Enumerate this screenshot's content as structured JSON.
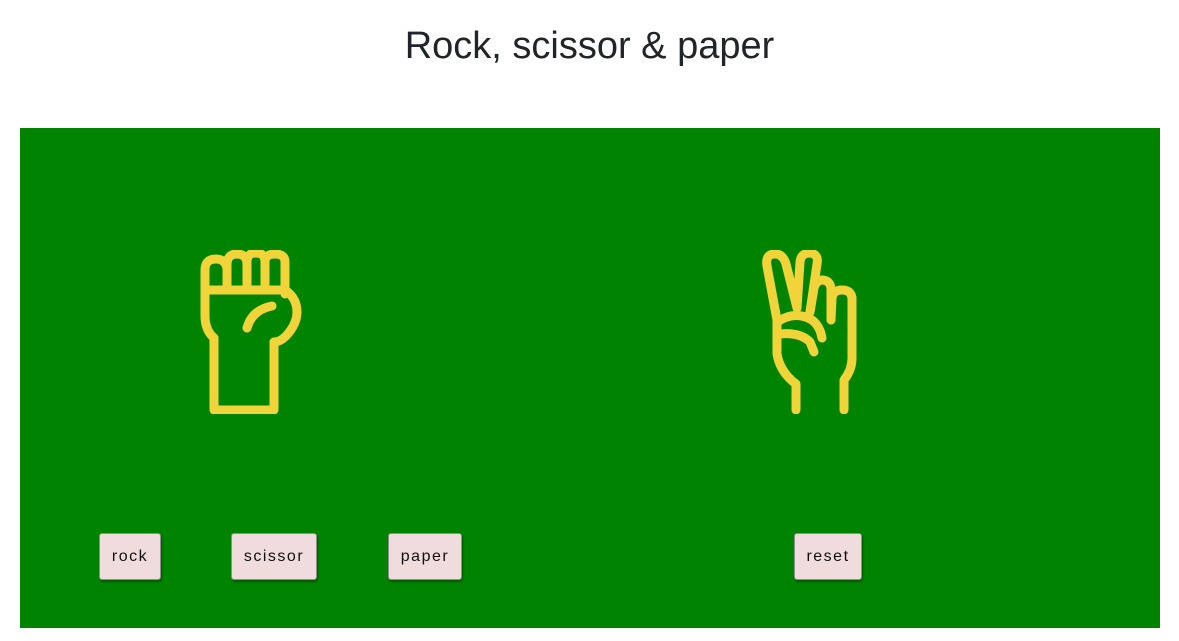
{
  "title": "Rock, scissor & paper",
  "colors": {
    "board": "#008400",
    "hand_stroke": "#f0d43a",
    "button_bg": "#f0dcdc"
  },
  "player": {
    "hand_icon": "rock-fist-icon"
  },
  "computer": {
    "hand_icon": "scissor-victory-hand-icon"
  },
  "buttons": {
    "rock": "rock",
    "scissor": "scissor",
    "paper": "paper",
    "reset": "reset"
  }
}
